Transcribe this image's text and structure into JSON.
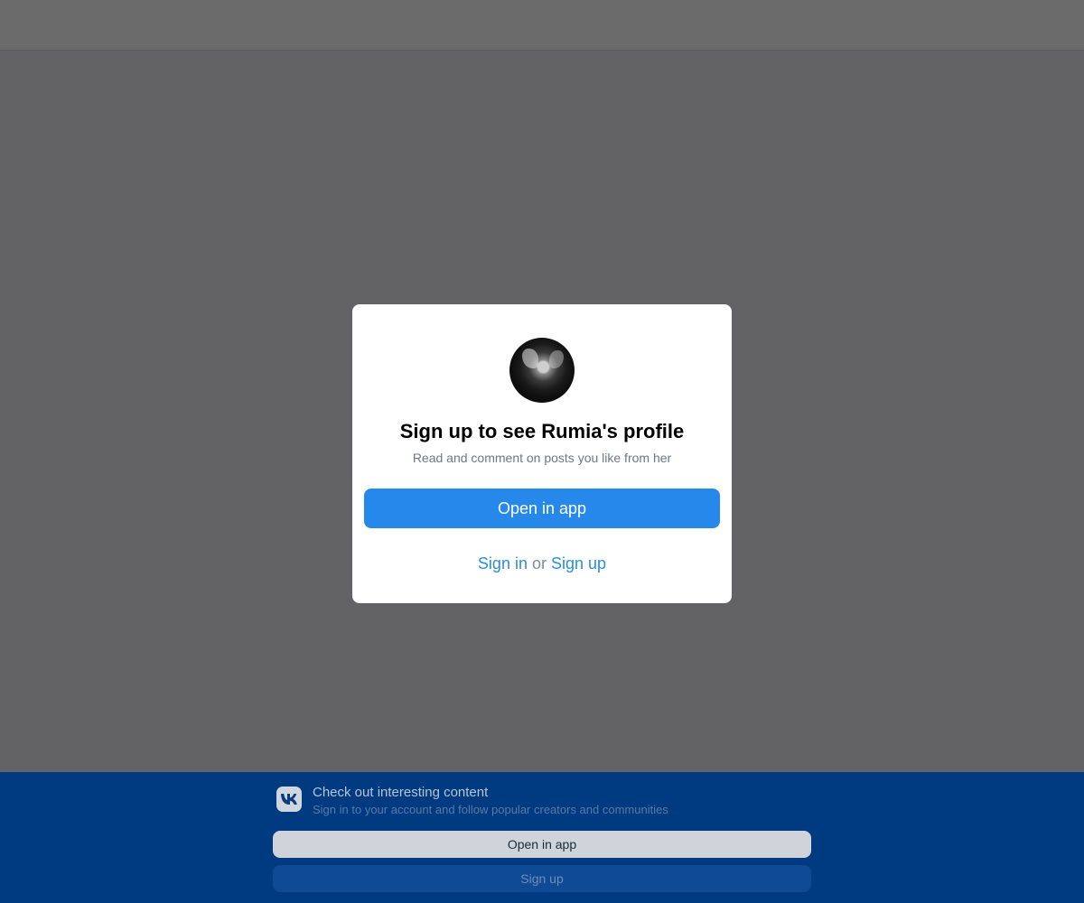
{
  "modal": {
    "title": "Sign up to see Rumia's profile",
    "subtitle": "Read and comment on posts you like from her",
    "open_app_label": "Open in app",
    "sign_in_label": "Sign in",
    "or_label": "or",
    "sign_up_label": "Sign up"
  },
  "banner": {
    "logo_icon": "vk-logo-icon",
    "title": "Check out interesting content",
    "subtitle": "Sign in to your account and follow popular creators and communities",
    "open_app_label": "Open in app",
    "sign_up_label": "Sign up"
  },
  "colors": {
    "accent": "#2688eb",
    "link": "#2a8fd6",
    "banner_bg": "#003a80",
    "overlay": "#636365"
  }
}
